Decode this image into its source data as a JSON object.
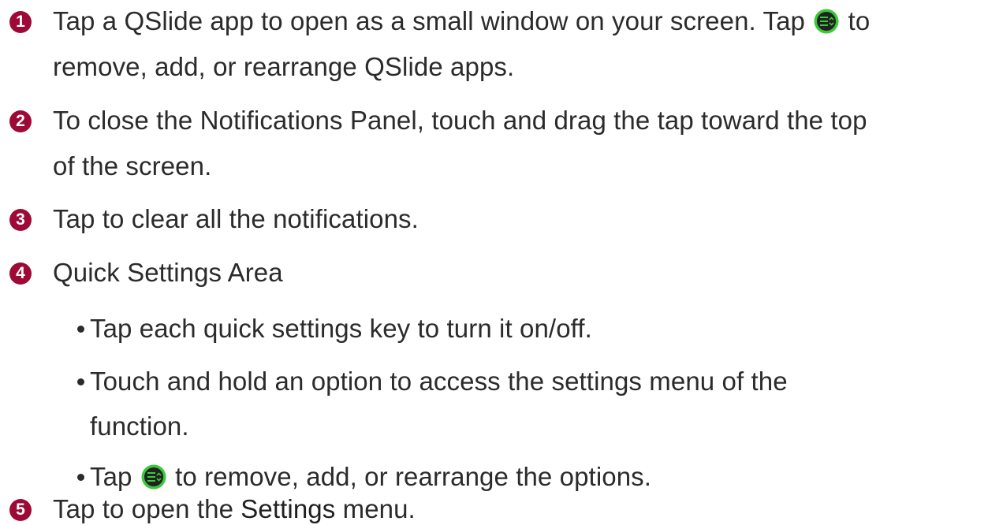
{
  "items": [
    {
      "number": "1",
      "line1_before": "Tap a QSlide app to open as a small window on your screen. Tap",
      "line1_after": "to",
      "line2": "remove, add, or rearrange QSlide apps."
    },
    {
      "number": "2",
      "line1": "To close the Notifications Panel, touch and drag the tap toward the top",
      "line2": "of the screen."
    },
    {
      "number": "3",
      "line1": "Tap to clear all the notifications."
    },
    {
      "number": "4",
      "heading": "Quick Settings Area",
      "bullets": [
        {
          "text": "Tap each quick settings key to turn it on/off."
        },
        {
          "line1": "Touch and hold an option to access the settings menu of the",
          "line2": "function."
        },
        {
          "before": "Tap",
          "after": "to remove, add, or rearrange the options."
        }
      ]
    },
    {
      "number": "5",
      "before": "Tap to open the ",
      "bold": "Settings",
      "after": " menu."
    }
  ],
  "icon": {
    "name": "edit-list-icon",
    "circle_color": "#3ac93a",
    "inner_color": "#222222"
  },
  "accent_color": "#9d0a35"
}
